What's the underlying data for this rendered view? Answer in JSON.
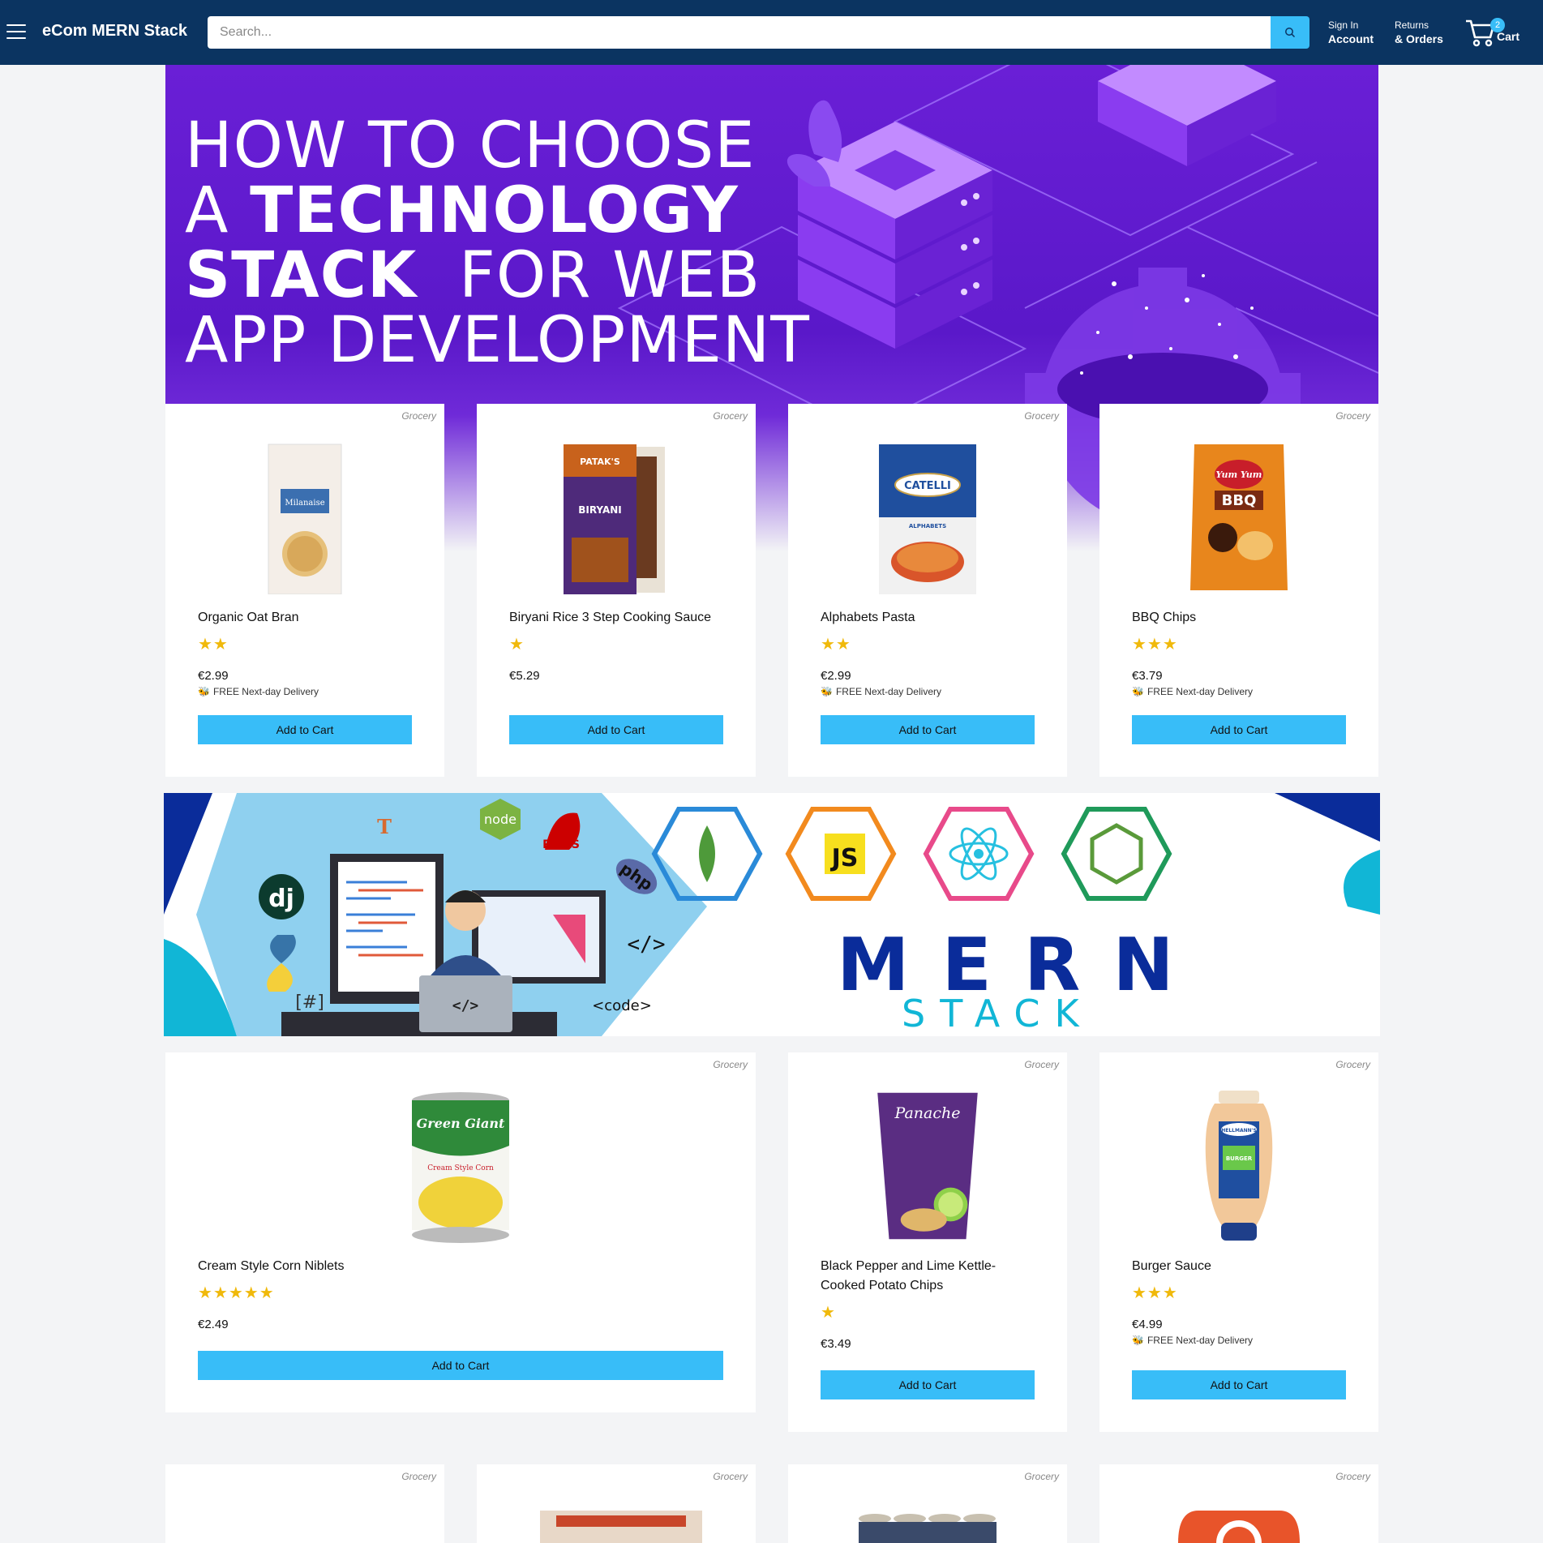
{
  "header": {
    "brand": "eCom MERN Stack",
    "search_placeholder": "Search...",
    "signin_small": "Sign In",
    "signin_big": "Account",
    "returns_small": "Returns",
    "returns_big": "& Orders",
    "cart_count": "2",
    "cart_label": "Cart"
  },
  "hero": {
    "line1": "HOW TO CHOOSE",
    "line2_a": "A",
    "line2_b": "TECHNOLOGY",
    "line3_a": "STACK",
    "line3_b": "FOR WEB",
    "line4": "APP DEVELOPMENT"
  },
  "mern_banner": {
    "word": "MERN",
    "sub": "STACK",
    "js_badge": "JS",
    "node_badge": "node",
    "rails_badge": "RAILS",
    "php_badge": "php",
    "code_tag1": "</>",
    "code_tag2": "<code>",
    "hash_tag": "[#]",
    "dj_badge": "dj",
    "laptop_code": "</>"
  },
  "products": [
    {
      "category": "Grocery",
      "name": "Organic Oat Bran",
      "rating": 2,
      "stars": "★★",
      "price": "€2.99",
      "delivery": "FREE Next-day Delivery",
      "button": "Add to Cart"
    },
    {
      "category": "Grocery",
      "name": "Biryani Rice 3 Step Cooking Sauce",
      "rating": 1,
      "stars": "★",
      "price": "€5.29",
      "delivery": "",
      "button": "Add to Cart"
    },
    {
      "category": "Grocery",
      "name": "Alphabets Pasta",
      "rating": 2,
      "stars": "★★",
      "price": "€2.99",
      "delivery": "FREE Next-day Delivery",
      "button": "Add to Cart"
    },
    {
      "category": "Grocery",
      "name": "BBQ Chips",
      "rating": 3,
      "stars": "★★★",
      "price": "€3.79",
      "delivery": "FREE Next-day Delivery",
      "button": "Add to Cart"
    },
    {
      "category": "Grocery",
      "name": "Cream Style Corn Niblets",
      "rating": 5,
      "stars": "★★★★★",
      "price": "€2.49",
      "delivery": "",
      "button": "Add to Cart"
    },
    {
      "category": "Grocery",
      "name": "Black Pepper and Lime Kettle-Cooked Potato Chips",
      "rating": 1,
      "stars": "★",
      "price": "€3.49",
      "delivery": "",
      "button": "Add to Cart"
    },
    {
      "category": "Grocery",
      "name": "Burger Sauce",
      "rating": 3,
      "stars": "★★★",
      "price": "€4.99",
      "delivery": "FREE Next-day Delivery",
      "button": "Add to Cart"
    },
    {
      "category": "Grocery"
    },
    {
      "category": "Grocery"
    },
    {
      "category": "Grocery"
    },
    {
      "category": "Grocery"
    }
  ],
  "product_labels": {
    "oat_brand": "Milanaise",
    "biryani_brand": "PATAK'S",
    "biryani_word": "BIRYANI",
    "pasta_brand": "CATELLI",
    "pasta_word": "ALPHABETS",
    "bbq_brand": "Yum Yum",
    "bbq_word": "BBQ",
    "corn_brand": "Green Giant",
    "corn_word": "Cream Style Corn",
    "chips_brand": "Panache",
    "sauce_brand": "HELLMANN'S",
    "sauce_word": "BURGER"
  },
  "colors": {
    "header": "#0b3461",
    "accent": "#38bdf8",
    "star": "#f0b90b",
    "hero": "#6a1fd6"
  }
}
